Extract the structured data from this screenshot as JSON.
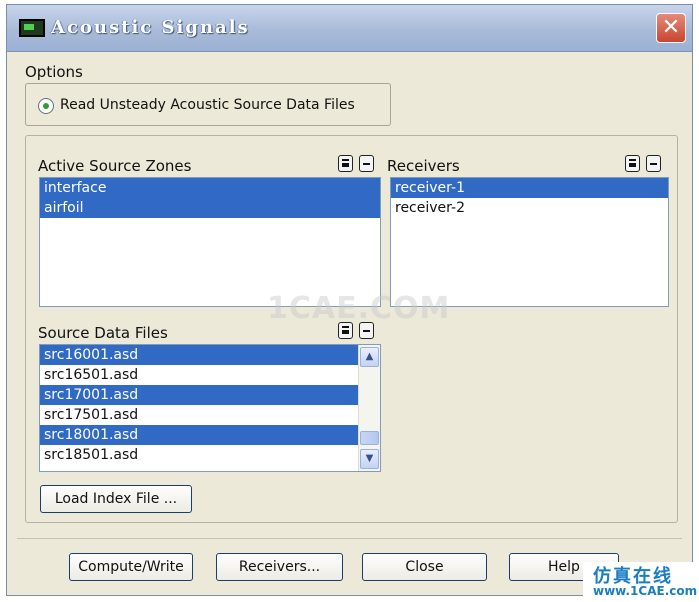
{
  "window": {
    "title": "Acoustic Signals",
    "close_glyph": "✕"
  },
  "options": {
    "label": "Options",
    "radio_label": "Read Unsteady Acoustic Source Data Files",
    "radio_selected": true
  },
  "active_source_zones": {
    "label": "Active Source Zones",
    "items": [
      {
        "text": "interface",
        "selected": true
      },
      {
        "text": "airfoil",
        "selected": true
      }
    ]
  },
  "receivers": {
    "label": "Receivers",
    "items": [
      {
        "text": "receiver-1",
        "selected": true
      },
      {
        "text": "receiver-2",
        "selected": false
      }
    ]
  },
  "source_data_files": {
    "label": "Source Data Files",
    "items": [
      {
        "text": "src16001.asd",
        "selected": true
      },
      {
        "text": "src16501.asd",
        "selected": false
      },
      {
        "text": "src17001.asd",
        "selected": true
      },
      {
        "text": "src17501.asd",
        "selected": false
      },
      {
        "text": "src18001.asd",
        "selected": true
      },
      {
        "text": "src18501.asd",
        "selected": false
      }
    ],
    "scroll_up_glyph": "▲",
    "scroll_down_glyph": "▼"
  },
  "load_index_button": "Load Index File ...",
  "buttons": {
    "compute_write": "Compute/Write",
    "receivers": "Receivers...",
    "close": "Close",
    "help": "Help"
  },
  "watermark": "1CAE.COM",
  "corner_badge": {
    "title": "仿真在线",
    "url": "www.1CAE.com"
  },
  "colors": {
    "selection": "#316ac5",
    "titlebar": "#a9bbd8",
    "dialog_bg": "#ece9d8"
  },
  "icons": {
    "app": "application-icon",
    "select_all": "select-all-icon",
    "deselect_all": "deselect-all-icon"
  }
}
